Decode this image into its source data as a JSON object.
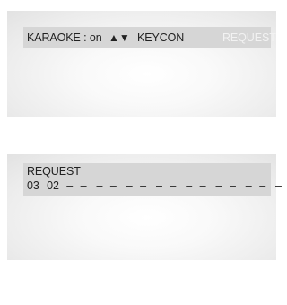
{
  "screen1": {
    "karaoke_status": "KARAOKE : on",
    "arrows_glyph": "▲▼",
    "keycon_label": "KEYCON",
    "request_label": "REQUEST"
  },
  "screen2": {
    "title": "REQUEST",
    "slots": [
      "03",
      "02",
      "– –",
      "– –",
      "– –",
      "– –",
      "– –",
      "– –",
      "– –",
      "– –"
    ]
  },
  "colors": {
    "bar_bg": "#d6d6d6",
    "highlight_text": "#f2f2f2",
    "text": "#222222"
  }
}
